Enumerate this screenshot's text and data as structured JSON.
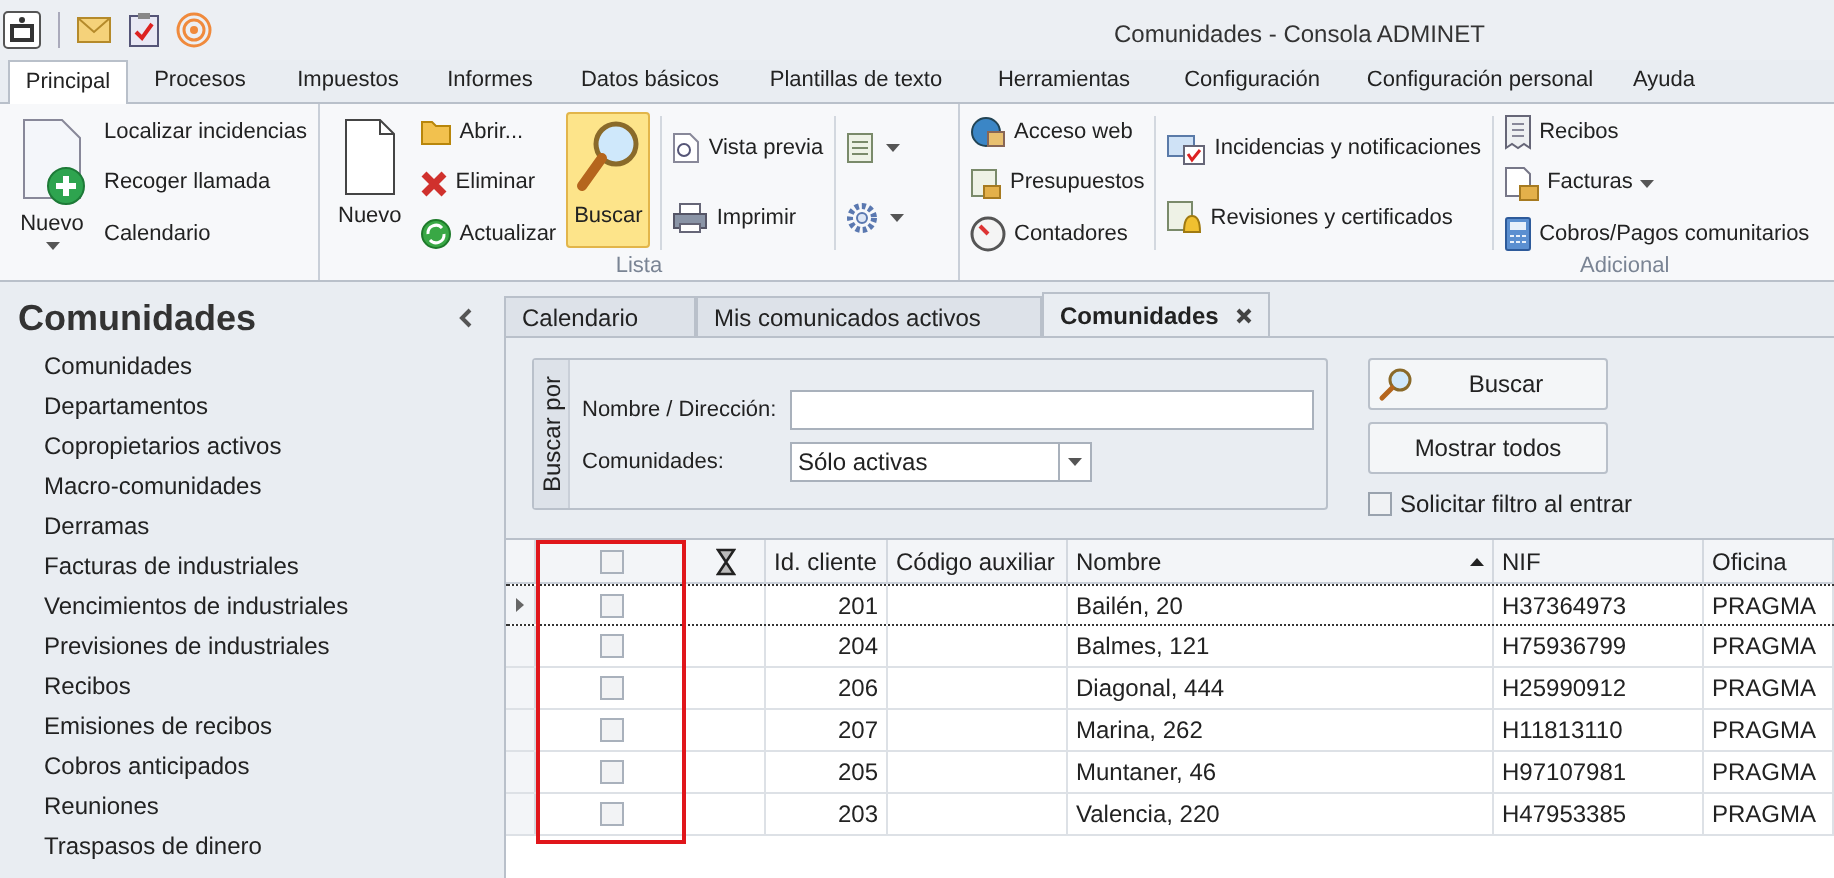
{
  "window": {
    "title": "Comunidades - Consola ADMINET"
  },
  "ribbon_tabs": [
    {
      "label": "Principal",
      "selected": true
    },
    {
      "label": "Procesos",
      "selected": false
    },
    {
      "label": "Impuestos",
      "selected": false
    },
    {
      "label": "Informes",
      "selected": false
    },
    {
      "label": "Datos básicos",
      "selected": false
    },
    {
      "label": "Plantillas de texto",
      "selected": false
    },
    {
      "label": "Herramientas",
      "selected": false
    },
    {
      "label": "Configuración",
      "selected": false
    },
    {
      "label": "Configuración personal",
      "selected": false
    },
    {
      "label": "Ayuda",
      "selected": false
    }
  ],
  "ribbon_groups": [
    {
      "sections": [
        [
          [
            {
              "kind": "large",
              "label": "Nuevo",
              "dropdown": true,
              "highlighted": false
            }
          ],
          [
            {
              "kind": "small",
              "label": "Localizar incidencias",
              "dropdown": false
            },
            {
              "kind": "small",
              "label": "Recoger llamada",
              "dropdown": false
            },
            {
              "kind": "small",
              "label": "Calendario",
              "dropdown": false
            }
          ]
        ]
      ]
    },
    {
      "label": "Lista",
      "sections": [
        [
          [
            {
              "kind": "large",
              "label": "Nuevo",
              "dropdown": false,
              "highlighted": false
            }
          ],
          [
            {
              "kind": "small",
              "label": "Abrir...",
              "dropdown": false
            },
            {
              "kind": "small",
              "label": "Eliminar",
              "dropdown": false
            },
            {
              "kind": "small",
              "label": "Actualizar",
              "dropdown": false
            }
          ],
          [
            {
              "kind": "large",
              "label": "Buscar",
              "dropdown": false,
              "highlighted": true
            }
          ]
        ],
        [
          [
            {
              "kind": "small",
              "label": "Vista previa",
              "dropdown": false
            },
            {
              "kind": "small",
              "label": "Imprimir",
              "dropdown": false
            }
          ]
        ],
        [
          [
            {
              "kind": "menu",
              "dropdown": true
            },
            {
              "kind": "menu",
              "dropdown": true
            }
          ]
        ]
      ]
    },
    {
      "label": "Adicional",
      "sections": [
        [
          [
            {
              "kind": "small",
              "label": "Acceso web",
              "dropdown": false
            },
            {
              "kind": "small",
              "label": "Presupuestos",
              "dropdown": false
            },
            {
              "kind": "small",
              "label": "Contadores",
              "dropdown": false
            }
          ]
        ],
        [
          [
            {
              "kind": "small",
              "label": "Incidencias y notificaciones",
              "dropdown": false
            },
            {
              "kind": "small",
              "label": "Revisiones y certificados",
              "dropdown": false
            }
          ]
        ],
        [
          [
            {
              "kind": "small",
              "label": "Recibos",
              "dropdown": false
            },
            {
              "kind": "small",
              "label": "Facturas",
              "dropdown": true
            },
            {
              "kind": "small",
              "label": "Cobros/Pagos comunitarios",
              "dropdown": false
            }
          ]
        ]
      ]
    }
  ],
  "sidebar": {
    "title": "Comunidades",
    "items": [
      {
        "label": "Comunidades"
      },
      {
        "label": "Departamentos"
      },
      {
        "label": "Copropietarios activos"
      },
      {
        "label": "Macro-comunidades"
      },
      {
        "label": "Derramas"
      },
      {
        "label": "Facturas de industriales"
      },
      {
        "label": "Vencimientos de industriales"
      },
      {
        "label": "Previsiones de industriales"
      },
      {
        "label": "Recibos"
      },
      {
        "label": "Emisiones de recibos"
      },
      {
        "label": "Cobros anticipados"
      },
      {
        "label": "Reuniones"
      },
      {
        "label": "Traspasos de dinero"
      }
    ]
  },
  "document_tabs": [
    {
      "label": "Calendario",
      "selected": false,
      "closable": false
    },
    {
      "label": "Mis comunicados activos",
      "selected": false,
      "closable": false
    },
    {
      "label": "Comunidades",
      "selected": true,
      "closable": true
    }
  ],
  "search_panel": {
    "caption": "Buscar por",
    "fields": [
      {
        "kind": "text",
        "label": "Nombre / Dirección:"
      },
      {
        "kind": "select",
        "label": "Comunidades:",
        "value": "Sólo activas"
      }
    ],
    "buttons": [
      {
        "label": "Buscar",
        "icon": true
      },
      {
        "label": "Mostrar todos",
        "icon": false
      }
    ],
    "option": {
      "label": "Solicitar filtro al entrar",
      "checked": false
    }
  },
  "grid": {
    "highlight_checkbox_column": true,
    "header_checked": false,
    "columns": [
      {
        "label": "Id. cliente",
        "kind": "number",
        "sorted": false
      },
      {
        "label": "Código auxiliar",
        "kind": "text",
        "sorted": false
      },
      {
        "label": "Nombre",
        "kind": "text",
        "sorted": true
      },
      {
        "label": "NIF",
        "kind": "text",
        "sorted": false
      },
      {
        "label": "Oficina",
        "kind": "text",
        "sorted": false
      }
    ],
    "rows": [
      {
        "current": true,
        "checked": false,
        "cells": [
          "201",
          "",
          "Bailén, 20",
          "H37364973",
          "PRAGMA"
        ]
      },
      {
        "current": false,
        "checked": false,
        "cells": [
          "204",
          "",
          "Balmes, 121",
          "H75936799",
          "PRAGMA"
        ]
      },
      {
        "current": false,
        "checked": false,
        "cells": [
          "206",
          "",
          "Diagonal, 444",
          "H25990912",
          "PRAGMA"
        ]
      },
      {
        "current": false,
        "checked": false,
        "cells": [
          "207",
          "",
          "Marina, 262",
          "H11813110",
          "PRAGMA"
        ]
      },
      {
        "current": false,
        "checked": false,
        "cells": [
          "205",
          "",
          "Muntaner, 46",
          "H97107981",
          "PRAGMA"
        ]
      },
      {
        "current": false,
        "checked": false,
        "cells": [
          "203",
          "",
          "Valencia, 220",
          "H47953385",
          "PRAGMA"
        ]
      }
    ]
  }
}
